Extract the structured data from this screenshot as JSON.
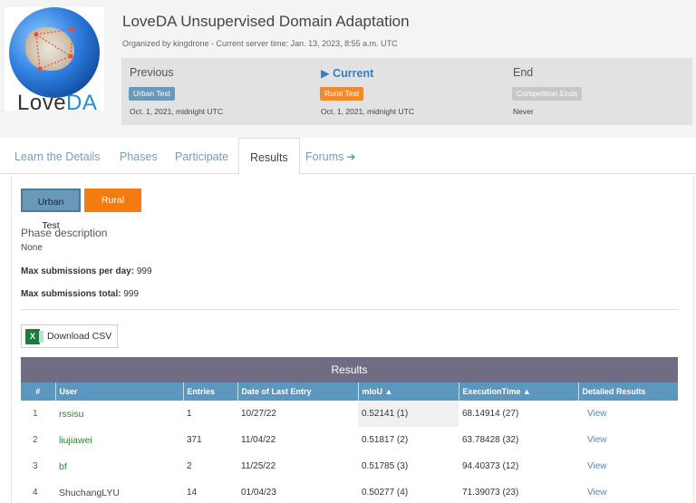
{
  "logo": {
    "text_main": "Love",
    "text_accent": "DA"
  },
  "title": "LoveDA Unsupervised Domain Adaptation",
  "subtitle": "Organized by kingdrone - Current server time: Jan. 13, 2023, 8:55 a.m. UTC",
  "phases": [
    {
      "name": "Previous",
      "badge": "Urban Test",
      "date": "Oct. 1, 2021, midnight UTC"
    },
    {
      "name": "Current",
      "badge": "Rural Test",
      "date": "Oct. 1, 2021, midnight UTC"
    },
    {
      "name": "End",
      "badge": "Competition Ends",
      "date": "Never"
    }
  ],
  "current_marker": "▶",
  "tabs": [
    "Learn the Details",
    "Phases",
    "Participate",
    "Results",
    "Forums"
  ],
  "phase_buttons": [
    "Urban Test",
    "Rural Test"
  ],
  "phase_description_label": "Phase description",
  "phase_description": "None",
  "max_per_day_label": "Max submissions per day:",
  "max_per_day": "999",
  "max_total_label": "Max submissions total:",
  "max_total": "999",
  "download_csv": "Download CSV",
  "results": {
    "title": "Results",
    "headers": [
      "#",
      "User",
      "Entries",
      "Date of Last Entry",
      "mIoU",
      "ExecutionTime",
      "Detailed Results"
    ],
    "sort_marker": "▲",
    "rows": [
      {
        "rank": "1",
        "user": "rssisu",
        "entries": "1",
        "date": "10/27/22",
        "miou": "0.52141 (1)",
        "exec": "68.14914 (27)",
        "detail": "View"
      },
      {
        "rank": "2",
        "user": "liujiawei",
        "entries": "371",
        "date": "11/04/22",
        "miou": "0.51817 (2)",
        "exec": "63.78428 (32)",
        "detail": "View"
      },
      {
        "rank": "3",
        "user": "bf",
        "entries": "2",
        "date": "11/25/22",
        "miou": "0.51785 (3)",
        "exec": "94.40373 (12)",
        "detail": "View"
      },
      {
        "rank": "4",
        "user": "ShuchangLYU",
        "entries": "14",
        "date": "01/04/23",
        "miou": "0.50277 (4)",
        "exec": "71.39073 (23)",
        "detail": "View"
      }
    ]
  },
  "colors": {
    "accent_blue": "#5b97bf",
    "accent_orange": "#f47b12",
    "results_header": "#6f6c83",
    "user_green": "#2e7d2e"
  }
}
